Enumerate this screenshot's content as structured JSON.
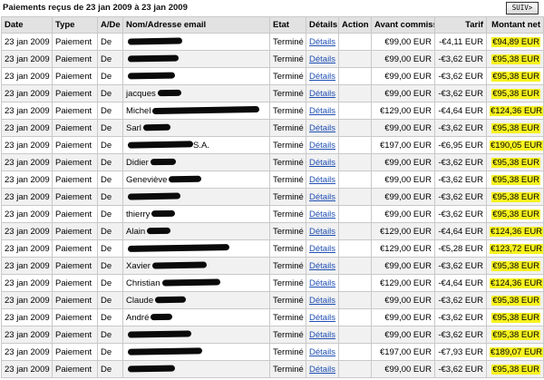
{
  "title": "Paiements reçus de 23 jan 2009 à 23 jan 2009",
  "next_button_label": "SUIV>",
  "columns": [
    "Date",
    "Type",
    "A/De",
    "Nom/Adresse email",
    "Etat",
    "Détails",
    "Action",
    "Avant commission",
    "Tarif",
    "Montant net"
  ],
  "rows": [
    {
      "date": "23 jan 2009",
      "type": "Paiement",
      "dir": "De",
      "name": "",
      "redact_w": 60,
      "status": "Terminé",
      "details": "Détails",
      "action": "",
      "gross": "€99,00 EUR",
      "fee": "-€4,11 EUR",
      "net": "€94,89 EUR"
    },
    {
      "date": "23 jan 2009",
      "type": "Paiement",
      "dir": "De",
      "name": "",
      "redact_w": 56,
      "status": "Terminé",
      "details": "Détails",
      "action": "",
      "gross": "€99,00 EUR",
      "fee": "-€3,62 EUR",
      "net": "€95,38 EUR"
    },
    {
      "date": "23 jan 2009",
      "type": "Paiement",
      "dir": "De",
      "name": "",
      "redact_w": 52,
      "status": "Terminé",
      "details": "Détails",
      "action": "",
      "gross": "€99,00 EUR",
      "fee": "-€3,62 EUR",
      "net": "€95,38 EUR"
    },
    {
      "date": "23 jan 2009",
      "type": "Paiement",
      "dir": "De",
      "name": "jacques",
      "redact_w": 26,
      "status": "Terminé",
      "details": "Détails",
      "action": "",
      "gross": "€99,00 EUR",
      "fee": "-€3,62 EUR",
      "net": "€95,38 EUR"
    },
    {
      "date": "23 jan 2009",
      "type": "Paiement",
      "dir": "De",
      "name": "Michel",
      "redact_w": 118,
      "status": "Terminé",
      "details": "Détails",
      "action": "",
      "gross": "€129,00 EUR",
      "fee": "-€4,64 EUR",
      "net": "€124,36 EUR"
    },
    {
      "date": "23 jan 2009",
      "type": "Paiement",
      "dir": "De",
      "name": "Sarl",
      "redact_w": 30,
      "status": "Terminé",
      "details": "Détails",
      "action": "",
      "gross": "€99,00 EUR",
      "fee": "-€3,62 EUR",
      "net": "€95,38 EUR"
    },
    {
      "date": "23 jan 2009",
      "type": "Paiement",
      "dir": "De",
      "name": "",
      "redact_w": 72,
      "suffix": "S.A.",
      "status": "Terminé",
      "details": "Détails",
      "action": "",
      "gross": "€197,00 EUR",
      "fee": "-€6,95 EUR",
      "net": "€190,05 EUR"
    },
    {
      "date": "23 jan 2009",
      "type": "Paiement",
      "dir": "De",
      "name": "Didier",
      "redact_w": 28,
      "status": "Terminé",
      "details": "Détails",
      "action": "",
      "gross": "€99,00 EUR",
      "fee": "-€3,62 EUR",
      "net": "€95,38 EUR"
    },
    {
      "date": "23 jan 2009",
      "type": "Paiement",
      "dir": "De",
      "name": "Geneviève",
      "redact_w": 36,
      "status": "Terminé",
      "details": "Détails",
      "action": "",
      "gross": "€99,00 EUR",
      "fee": "-€3,62 EUR",
      "net": "€95,38 EUR"
    },
    {
      "date": "23 jan 2009",
      "type": "Paiement",
      "dir": "De",
      "name": "",
      "redact_w": 58,
      "status": "Terminé",
      "details": "Détails",
      "action": "",
      "gross": "€99,00 EUR",
      "fee": "-€3,62 EUR",
      "net": "€95,38 EUR"
    },
    {
      "date": "23 jan 2009",
      "type": "Paiement",
      "dir": "De",
      "name": "thierry",
      "redact_w": 26,
      "status": "Terminé",
      "details": "Détails",
      "action": "",
      "gross": "€99,00 EUR",
      "fee": "-€3,62 EUR",
      "net": "€95,38 EUR"
    },
    {
      "date": "23 jan 2009",
      "type": "Paiement",
      "dir": "De",
      "name": "Alain",
      "redact_w": 26,
      "status": "Terminé",
      "details": "Détails",
      "action": "",
      "gross": "€129,00 EUR",
      "fee": "-€4,64 EUR",
      "net": "€124,36 EUR"
    },
    {
      "date": "23 jan 2009",
      "type": "Paiement",
      "dir": "De",
      "name": "",
      "redact_w": 112,
      "status": "Terminé",
      "details": "Détails",
      "action": "",
      "gross": "€129,00 EUR",
      "fee": "-€5,28 EUR",
      "net": "€123,72 EUR"
    },
    {
      "date": "23 jan 2009",
      "type": "Paiement",
      "dir": "De",
      "name": "Xavier",
      "redact_w": 60,
      "status": "Terminé",
      "details": "Détails",
      "action": "",
      "gross": "€99,00 EUR",
      "fee": "-€3,62 EUR",
      "net": "€95,38 EUR"
    },
    {
      "date": "23 jan 2009",
      "type": "Paiement",
      "dir": "De",
      "name": "Christian",
      "redact_w": 64,
      "status": "Terminé",
      "details": "Détails",
      "action": "",
      "gross": "€129,00 EUR",
      "fee": "-€4,64 EUR",
      "net": "€124,36 EUR"
    },
    {
      "date": "23 jan 2009",
      "type": "Paiement",
      "dir": "De",
      "name": "Claude",
      "redact_w": 34,
      "status": "Terminé",
      "details": "Détails",
      "action": "",
      "gross": "€99,00 EUR",
      "fee": "-€3,62 EUR",
      "net": "€95,38 EUR"
    },
    {
      "date": "23 jan 2009",
      "type": "Paiement",
      "dir": "De",
      "name": "André",
      "redact_w": 24,
      "status": "Terminé",
      "details": "Détails",
      "action": "",
      "gross": "€99,00 EUR",
      "fee": "-€3,62 EUR",
      "net": "€95,38 EUR"
    },
    {
      "date": "23 jan 2009",
      "type": "Paiement",
      "dir": "De",
      "name": "",
      "redact_w": 70,
      "status": "Terminé",
      "details": "Détails",
      "action": "",
      "gross": "€99,00 EUR",
      "fee": "-€3,62 EUR",
      "net": "€95,38 EUR"
    },
    {
      "date": "23 jan 2009",
      "type": "Paiement",
      "dir": "De",
      "name": "",
      "redact_w": 82,
      "status": "Terminé",
      "details": "Détails",
      "action": "",
      "gross": "€197,00 EUR",
      "fee": "-€7,93 EUR",
      "net": "€189,07 EUR"
    },
    {
      "date": "23 jan 2009",
      "type": "Paiement",
      "dir": "De",
      "name": "",
      "redact_w": 52,
      "status": "Terminé",
      "details": "Détails",
      "action": "",
      "gross": "€99,00 EUR",
      "fee": "-€3,62 EUR",
      "net": "€95,38 EUR"
    }
  ],
  "colors": {
    "highlight": "#f7f21f",
    "link": "#1f4fb3",
    "header_bg": "#e2e2e2",
    "row_alt": "#f1f1f1"
  }
}
